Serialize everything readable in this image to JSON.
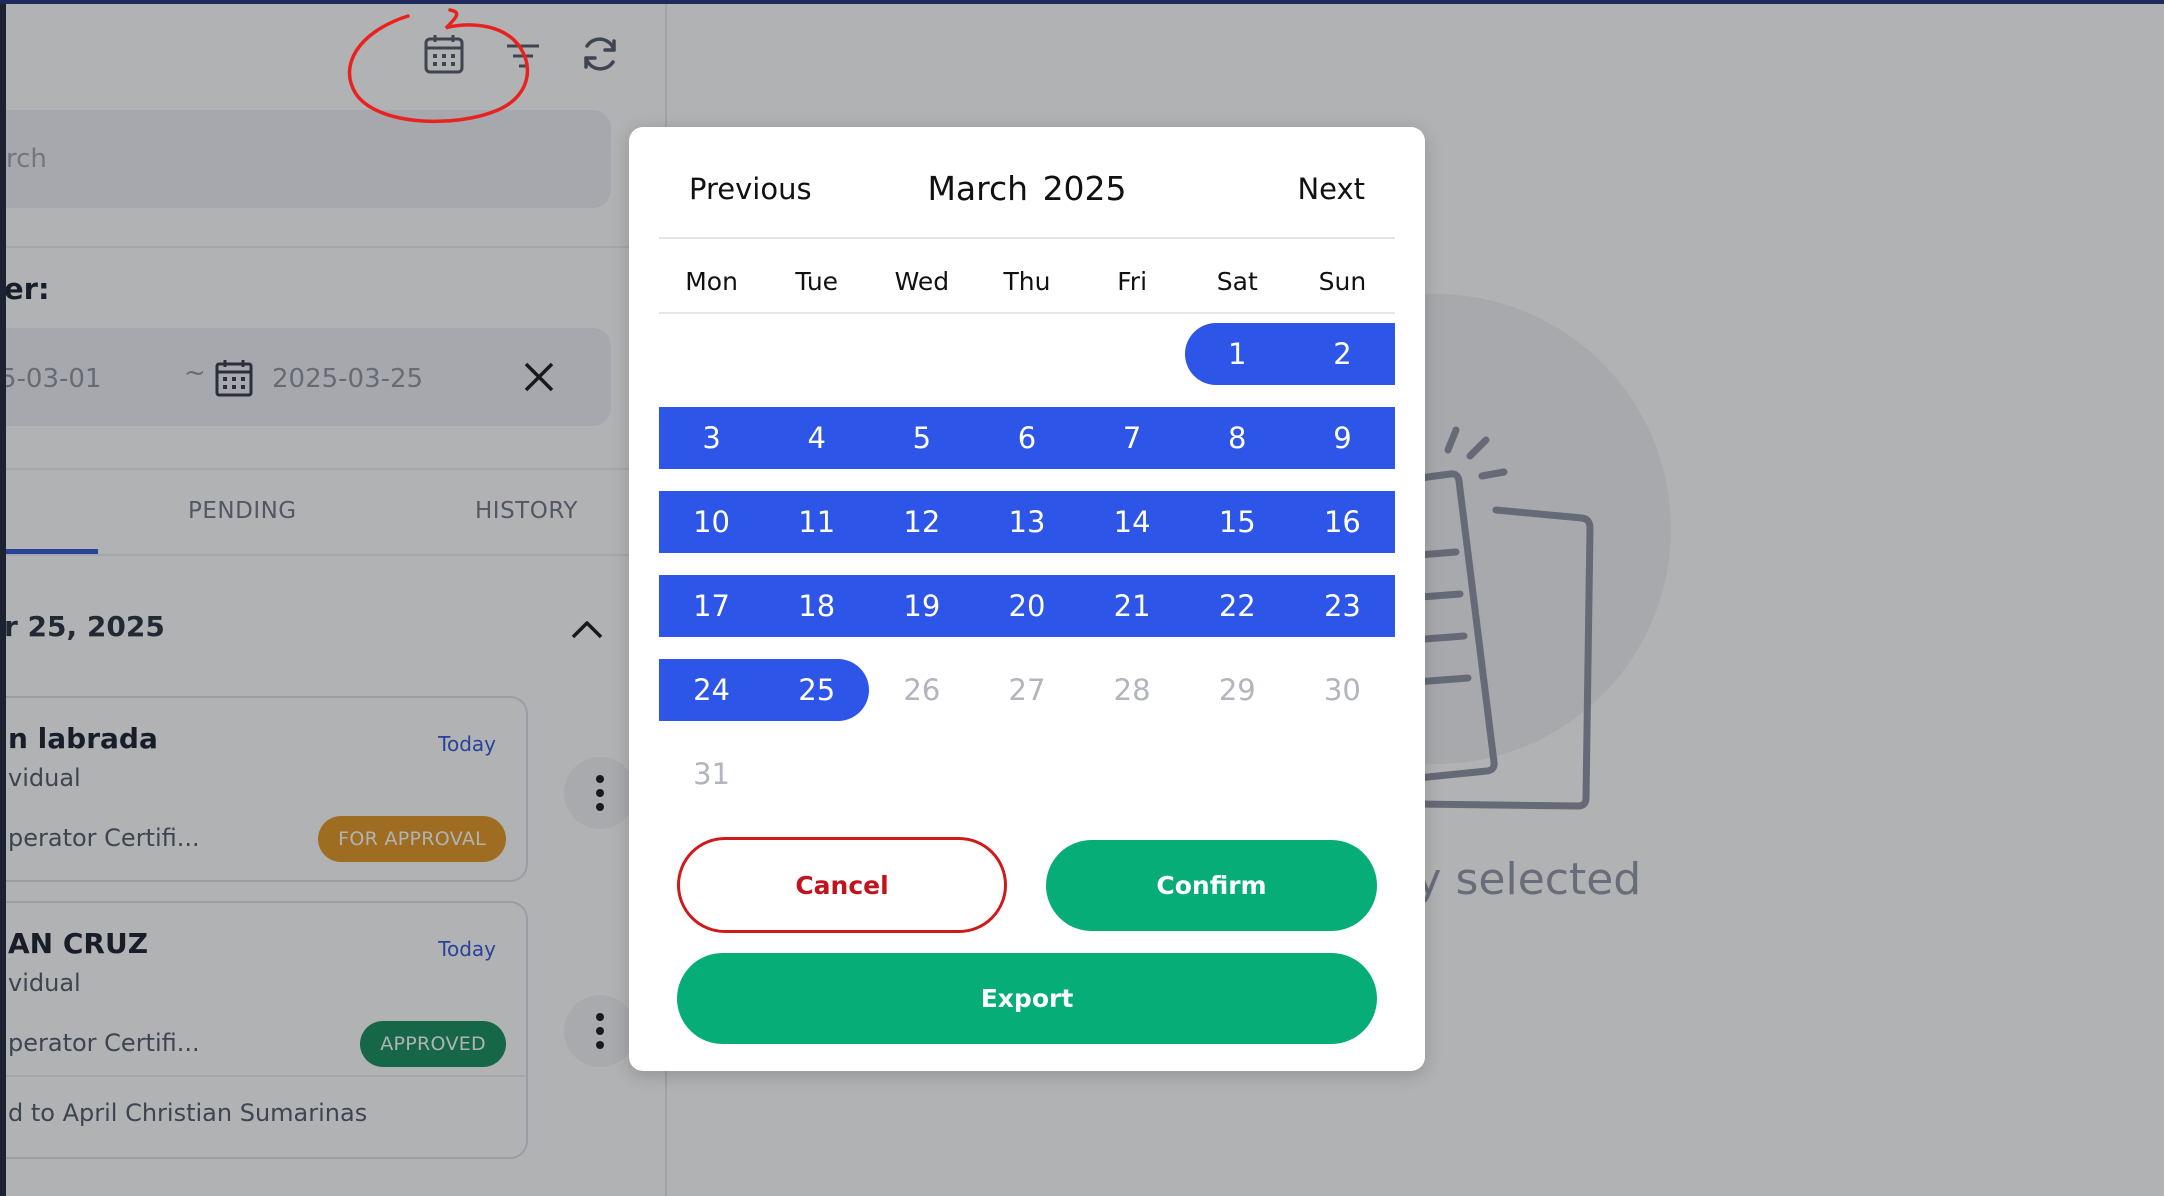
{
  "search": {
    "placeholder": "rch"
  },
  "filter": {
    "label": "er:",
    "date_from": "5-03-01",
    "separator": "~",
    "date_to": "2025-03-25"
  },
  "tabs": [
    {
      "label": "PENDING"
    },
    {
      "label": "HISTORY"
    }
  ],
  "group": {
    "date": "r 25, 2025"
  },
  "cards": [
    {
      "name": "n labrada",
      "type": "vidual",
      "when": "Today",
      "service": "perator Certifi...",
      "status": "FOR APPROVAL"
    },
    {
      "name": "AN CRUZ",
      "type": "vidual",
      "when": "Today",
      "service": "perator Certifi...",
      "status": "APPROVED",
      "note": "d to April Christian Sumarinas"
    }
  ],
  "empty_state": {
    "text": "ity selected"
  },
  "date_picker": {
    "prev_label": "Previous",
    "next_label": "Next",
    "month": "March",
    "year": "2025",
    "weekdays": [
      "Mon",
      "Tue",
      "Wed",
      "Thu",
      "Fri",
      "Sat",
      "Sun"
    ],
    "first_weekday_index": 5,
    "days_in_month": 31,
    "selected_start": 1,
    "selected_end": 25,
    "cancel_label": "Cancel",
    "confirm_label": "Confirm",
    "export_label": "Export"
  },
  "colors": {
    "accent": "#2d55e8",
    "confirm": "#06ad76",
    "cancel": "#c0131c",
    "badge_approval": "#e2931c",
    "badge_approved": "#0c8a57",
    "annotation": "#e8231f"
  },
  "icons": {
    "header": [
      "calendar-icon",
      "filter-icon",
      "refresh-icon"
    ],
    "date_field": "calendar-icon",
    "clear": "close-icon",
    "group_toggle": "chevron-up-icon",
    "card_menu": "kebab-menu-icon"
  }
}
